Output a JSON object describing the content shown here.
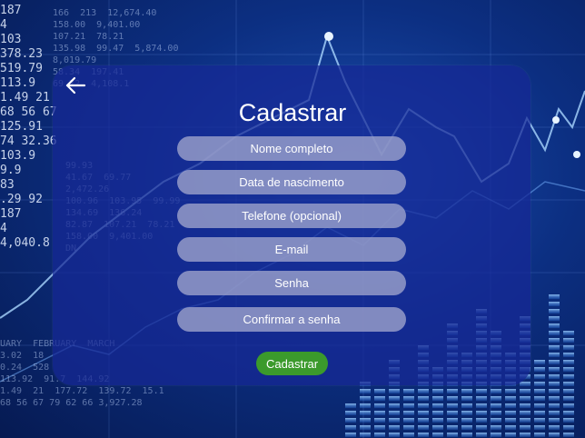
{
  "background": {
    "ticker_left": [
      "187",
      "4",
      "103",
      "378.23",
      "519.79",
      "113.9",
      "1.49 21",
      "68 56 67",
      "125.91",
      "74 32.36",
      "103.9",
      "9.9",
      "83",
      ".29 92",
      "187",
      "4",
      "4,040.8"
    ],
    "ticker_top": [
      "166  213  12,674.40",
      "158.00  9,401.00",
      "107.21  78.21",
      "135.98  99.47  5,874.00",
      "8,019.79",
      "58.34  197.41",
      "69.72  4,108.1"
    ],
    "ticker_bottom": [
      "UARY  FEBRUARY  MARCH",
      "3.02  18",
      "0.24  528",
      "113.92  91.7  144.92",
      "1.49  21  177.72  139.72  15.1",
      "68 56 67 79 62 66 3,927.28"
    ],
    "ticker_mid": [
      "99.93",
      "41.67  69.77",
      "2,472.26",
      "100.96  103.95  99.99",
      "134.69  136.24",
      "82.87  107.21  78.21",
      "158.00  9,401.00",
      "DN"
    ]
  },
  "back_icon": "arrow-left-icon",
  "title": "Cadastrar",
  "form": {
    "fields": [
      {
        "name": "full-name-field",
        "placeholder": "Nome completo",
        "type": "text"
      },
      {
        "name": "birth-date-field",
        "placeholder": "Data de nascimento",
        "type": "text"
      },
      {
        "name": "phone-field",
        "placeholder": "Telefone (opcional)",
        "type": "tel"
      },
      {
        "name": "email-field",
        "placeholder": "E-mail",
        "type": "email"
      },
      {
        "name": "password-field",
        "placeholder": "Senha",
        "type": "password"
      },
      {
        "name": "confirm-password-field",
        "placeholder": "Confirmar a senha",
        "type": "password"
      }
    ],
    "submit_label": "Cadastrar"
  },
  "colors": {
    "card": "#1628a0",
    "field": "#a0a5cd",
    "submit": "#3b9a2c",
    "text": "#ffffff"
  }
}
